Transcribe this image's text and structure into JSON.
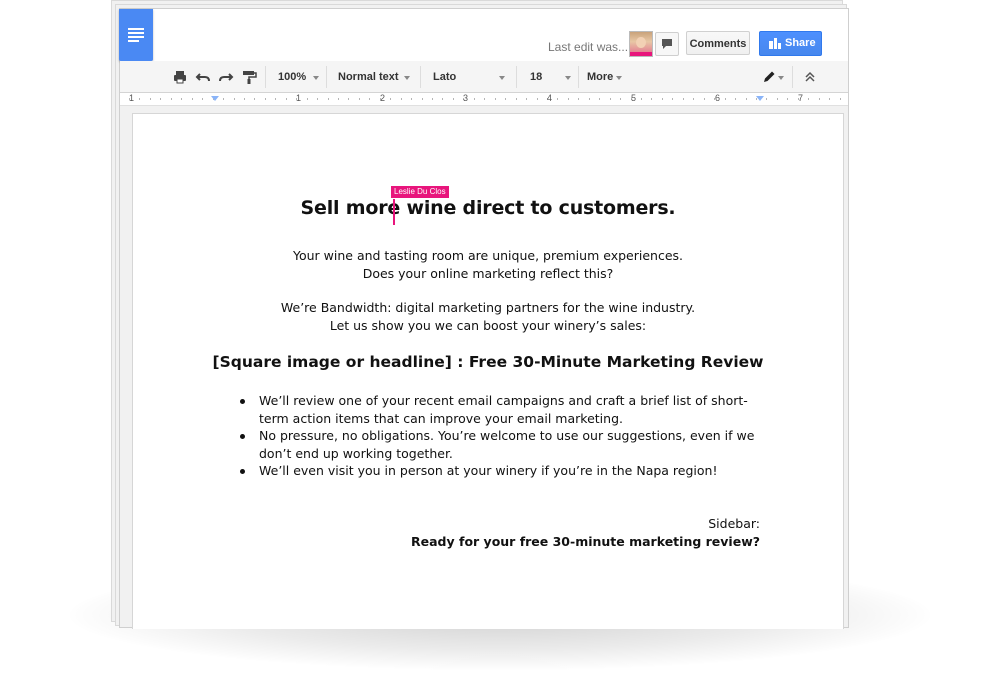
{
  "header": {
    "last_edit": "Last edit was...",
    "comments_label": "Comments",
    "share_label": "Share"
  },
  "toolbar": {
    "zoom": "100%",
    "style": "Normal text",
    "font": "Lato",
    "size": "18",
    "more": "More"
  },
  "ruler": {
    "numbers": [
      "1",
      "1",
      "2",
      "3",
      "4",
      "5",
      "6",
      "7"
    ]
  },
  "collaborator": {
    "name": "Leslie Du Clos",
    "color": "#e8157c"
  },
  "document": {
    "title": "Sell more wine direct to customers.",
    "paragraph1": [
      "Your wine and tasting room are unique, premium experiences.",
      "Does your online marketing reflect this?"
    ],
    "paragraph2": [
      "We’re Bandwidth: digital marketing partners for the wine industry.",
      "Let us show you we can boost your winery’s sales:"
    ],
    "subheading": "[Square image or headline] : Free 30-Minute Marketing Review",
    "bullets": [
      "We’ll review one of your recent email campaigns and craft a brief list of short-term action items that can improve your email marketing.",
      "No pressure, no obligations. You’re welcome to use our suggestions, even if we don’t end up working together.",
      "We’ll even visit you in person at your winery if you’re in the Napa region!"
    ],
    "sidebar_label": "Sidebar:",
    "sidebar_cta": "Ready for your free 30-minute marketing review?"
  },
  "icons": {
    "logo": "docs-logo-icon",
    "print": "print-icon",
    "undo": "undo-icon",
    "redo": "redo-icon",
    "paint_format": "paint-format-icon",
    "edit_mode": "pencil-icon",
    "collapse": "collapse-icon",
    "comment": "comment-icon",
    "share": "share-icon"
  },
  "colors": {
    "accent": "#4d90fe",
    "collaborator": "#e8157c"
  }
}
